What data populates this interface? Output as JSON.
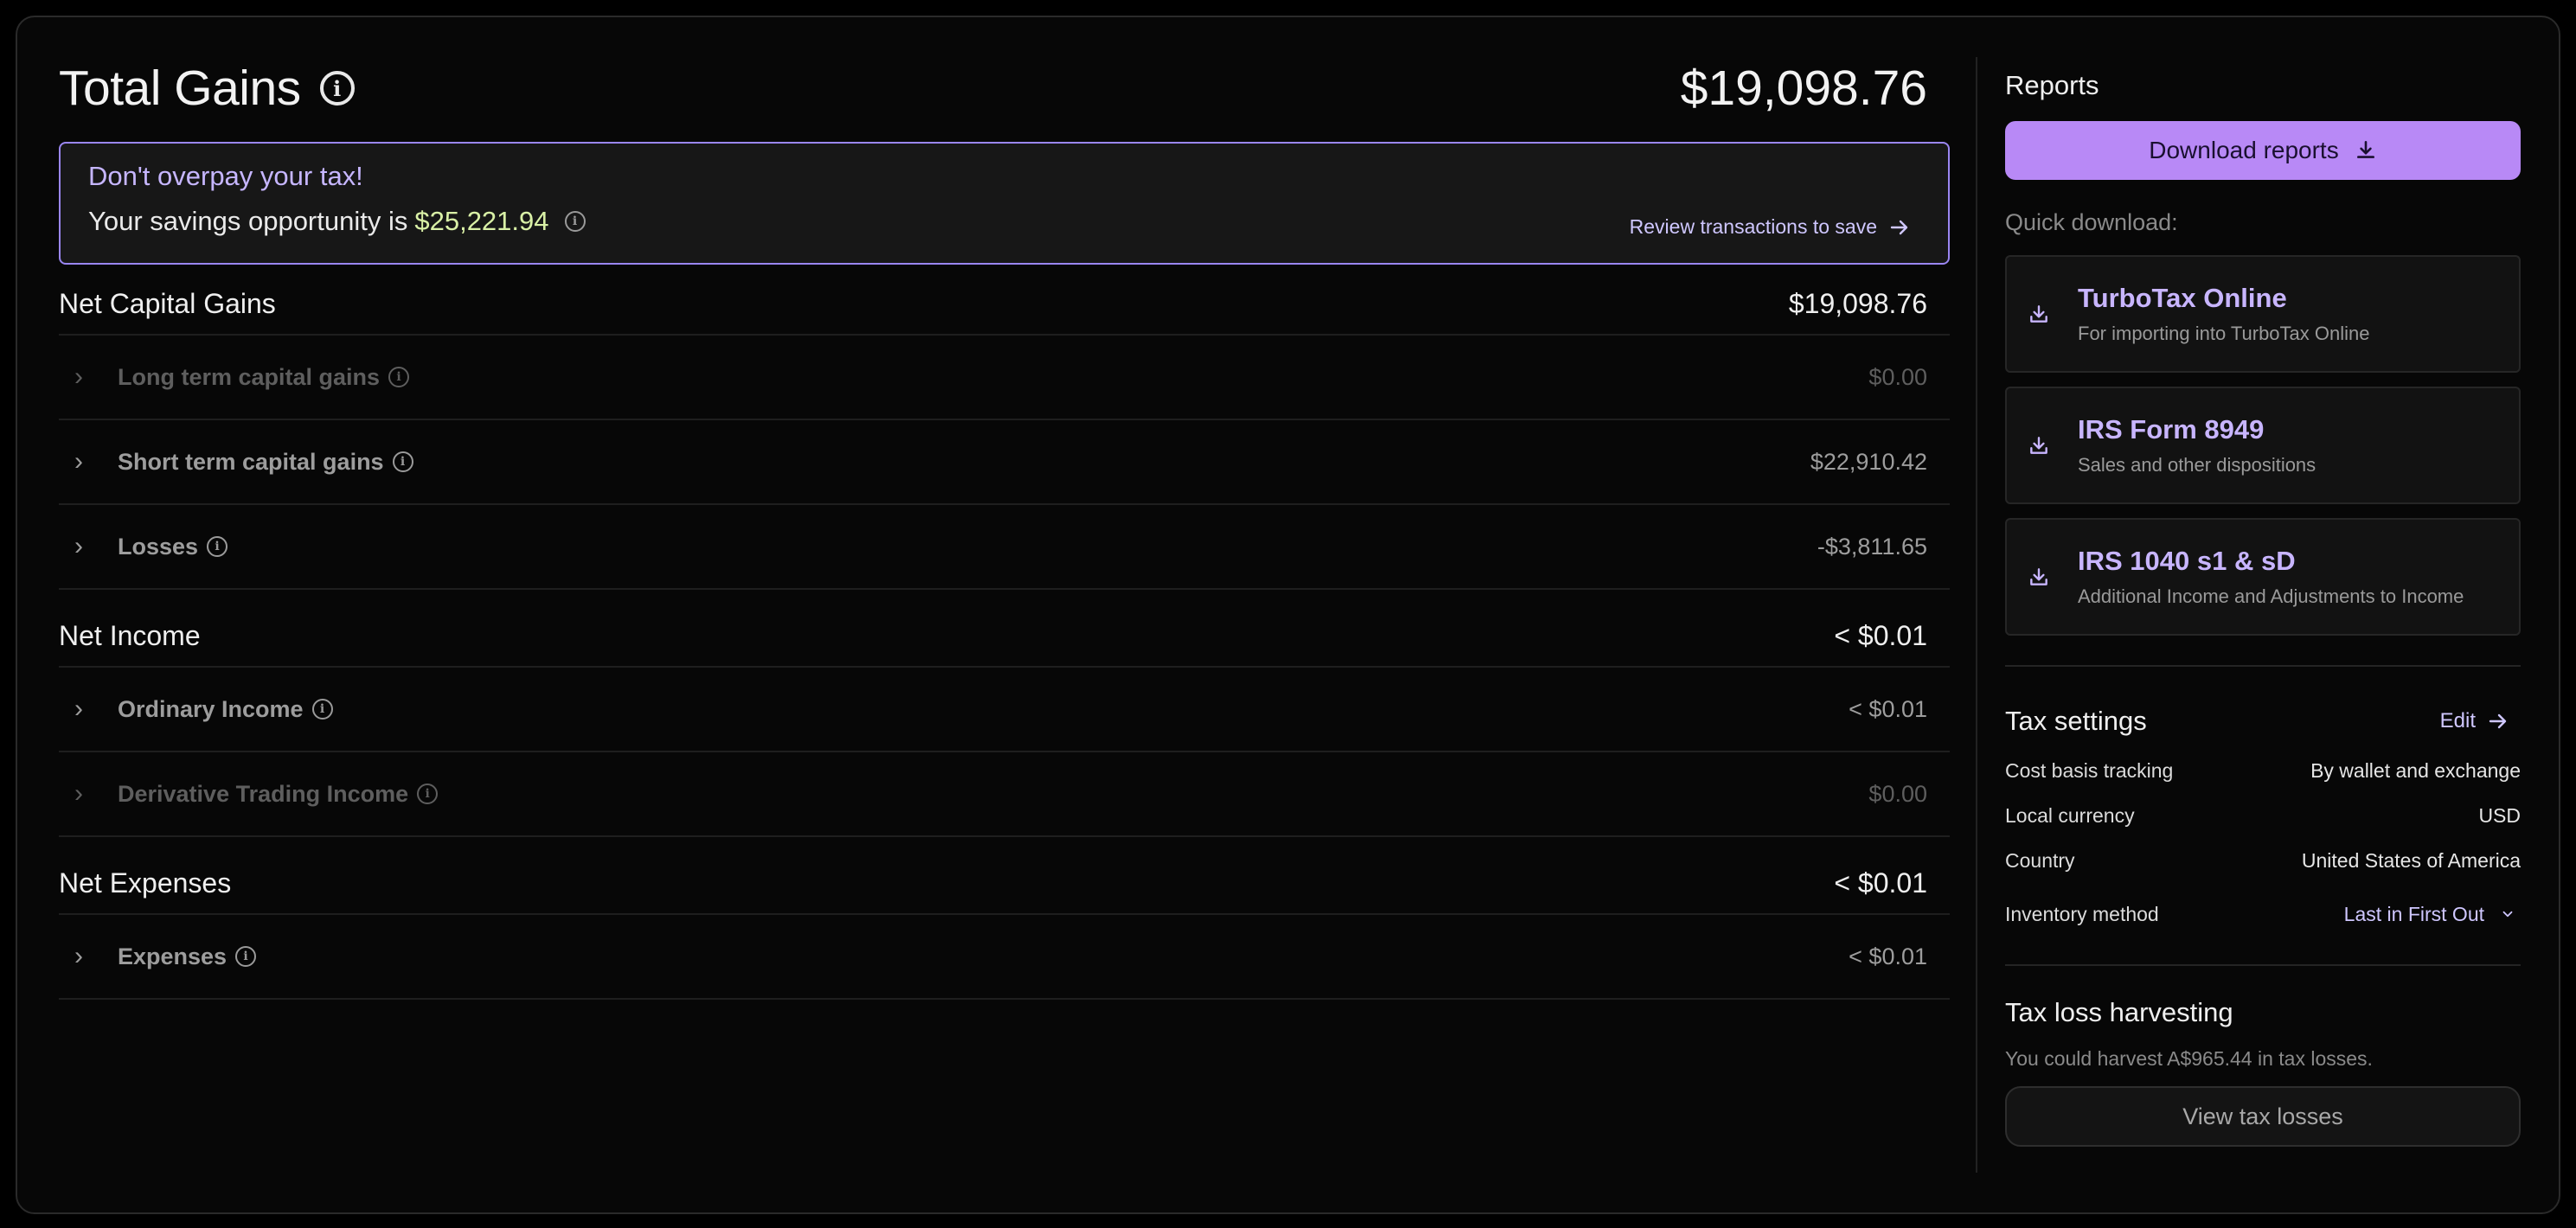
{
  "header": {
    "title": "Total Gains",
    "total": "$19,098.76"
  },
  "savings": {
    "title": "Don't overpay your tax!",
    "prefix": "Your savings opportunity is",
    "amount": "$25,221.94",
    "link": "Review transactions to save"
  },
  "sections": [
    {
      "title": "Net Capital Gains",
      "value": "$19,098.76",
      "rows": [
        {
          "label": "Long term capital gains",
          "value": "$0.00"
        },
        {
          "label": "Short term capital gains",
          "value": "$22,910.42"
        },
        {
          "label": "Losses",
          "value": "-$3,811.65"
        }
      ]
    },
    {
      "title": "Net Income",
      "value": "< $0.01",
      "rows": [
        {
          "label": "Ordinary Income",
          "value": "< $0.01"
        },
        {
          "label": "Derivative Trading Income",
          "value": "$0.00"
        }
      ]
    },
    {
      "title": "Net Expenses",
      "value": "< $0.01",
      "rows": [
        {
          "label": "Expenses",
          "value": "< $0.01"
        }
      ]
    }
  ],
  "reports": {
    "title": "Reports",
    "download_button": "Download reports",
    "quick_label": "Quick download:",
    "cards": [
      {
        "title": "TurboTax Online",
        "subtitle": "For importing into TurboTax Online"
      },
      {
        "title": "IRS Form 8949",
        "subtitle": "Sales and other dispositions"
      },
      {
        "title": "IRS 1040 s1 & sD",
        "subtitle": "Additional Income and Adjustments to Income"
      }
    ]
  },
  "tax_settings": {
    "title": "Tax settings",
    "edit": "Edit",
    "items": [
      {
        "key": "Cost basis tracking",
        "value": "By wallet and exchange"
      },
      {
        "key": "Local currency",
        "value": "USD"
      },
      {
        "key": "Country",
        "value": "United States of America"
      },
      {
        "key": "Inventory method",
        "value": "Last in First Out"
      }
    ]
  },
  "tax_loss": {
    "title": "Tax loss harvesting",
    "subtitle": "You could harvest A$965.44 in tax losses.",
    "button": "View tax losses"
  },
  "colors": {
    "accent": "#b889f6",
    "savings_amount": "#d9f0a6",
    "link": "#cfc7ff"
  }
}
